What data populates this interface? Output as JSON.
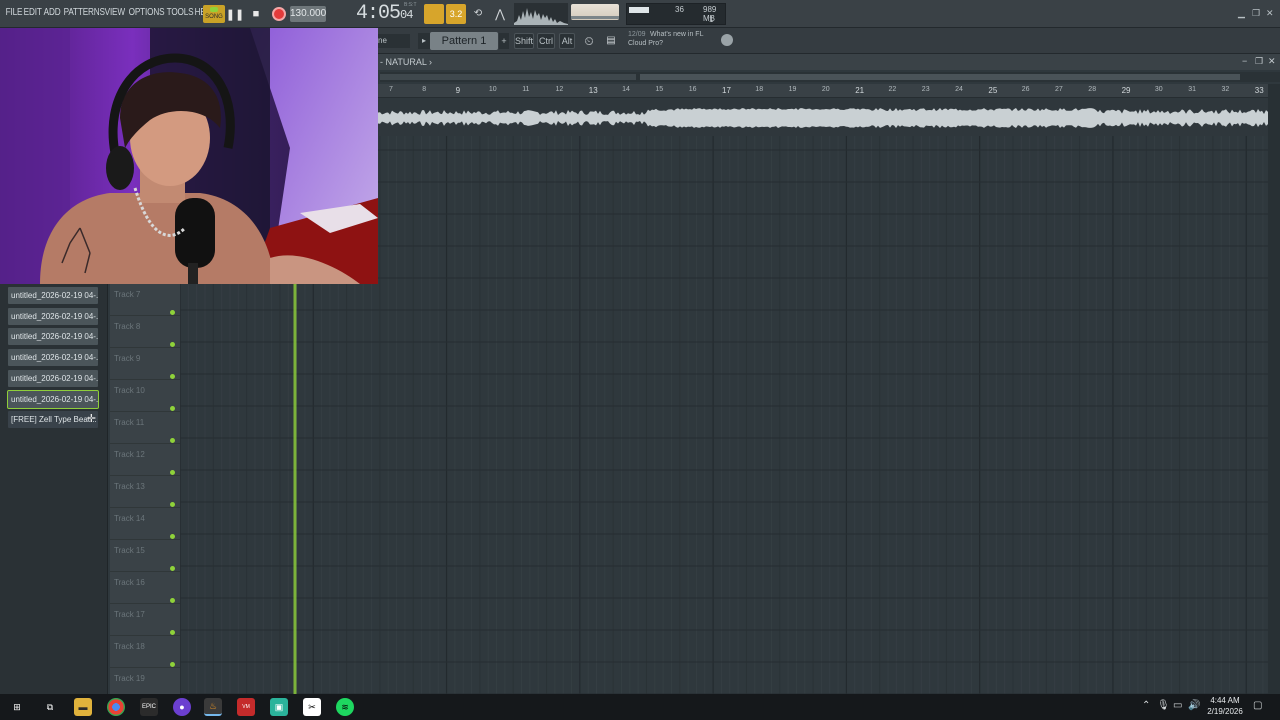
{
  "menu": [
    "FILE",
    "EDIT",
    "ADD",
    "PATTERNS",
    "VIEW",
    "OPTIONS",
    "TOOLS",
    "HELP"
  ],
  "transport": {
    "song_label": "SONG",
    "tempo": "130.000",
    "time": "4:05",
    "time_small": "04",
    "time_sub": "B:S:T"
  },
  "cpu": {
    "value": "36",
    "memory": "989 MB",
    "polyphony": "1"
  },
  "toolbar2": {
    "browser_mode": "ne",
    "pattern": "Pattern 1",
    "pattern_add": "+",
    "shift": "Shift",
    "ctrl": "Ctrl",
    "alt": "Alt",
    "news_date": "12/09",
    "news_line1": "What's new in FL",
    "news_line2": "Cloud Pro?"
  },
  "playlist": {
    "title": "NATURAL",
    "title_prefix": "-",
    "bar_numbers": [
      "7",
      "8",
      "9",
      "10",
      "11",
      "12",
      "13",
      "14",
      "15",
      "16",
      "17",
      "18",
      "19",
      "20",
      "21",
      "22",
      "23",
      "24",
      "25",
      "26",
      "27",
      "28",
      "29",
      "30",
      "31",
      "32",
      "33"
    ]
  },
  "samples": [
    "untitled_2026-02-19 04-...",
    "untitled_2026-02-19 04-...",
    "untitled_2026-02-19 04-...",
    "untitled_2026-02-19 04-...",
    "untitled_2026-02-19 04-...",
    "untitled_2026-02-19 04-...",
    "[FREE] Zell Type Beat..."
  ],
  "tracks": [
    "Track 7",
    "Track 8",
    "Track 9",
    "Track 10",
    "Track 11",
    "Track 12",
    "Track 13",
    "Track 14",
    "Track 15",
    "Track 16",
    "Track 17",
    "Track 18",
    "Track 19"
  ],
  "taskbar": {
    "time": "4:44 AM",
    "date": "2/19/2026",
    "apps": [
      "windows-start",
      "task-view",
      "file-explorer",
      "chrome",
      "epic-games",
      "app-purple",
      "fl-studio",
      "voicemeeter",
      "app-teal",
      "capcut",
      "spotify"
    ]
  },
  "colors": {
    "accent_green": "#8fd23a",
    "song_orange": "#c9a227",
    "record_red": "#e33b3b"
  }
}
